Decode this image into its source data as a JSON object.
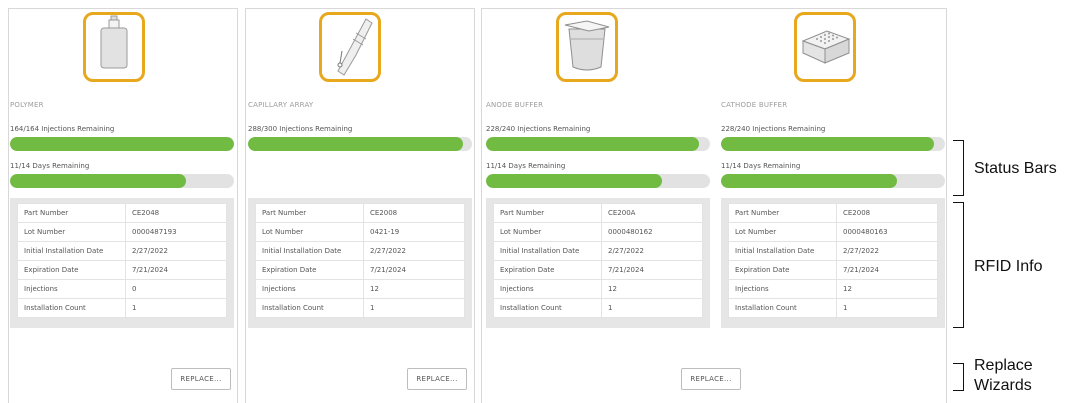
{
  "consumables": [
    {
      "name": "POLYMER",
      "icon": "polymer-pouch-icon",
      "injections_label": "164/164 Injections Remaining",
      "injections_fraction": 1.0,
      "days_label": "11/14 Days Remaining",
      "days_fraction": 0.786,
      "rfid": [
        {
          "label": "Part Number",
          "value": "CE2048"
        },
        {
          "label": "Lot Number",
          "value": "0000487193"
        },
        {
          "label": "Initial Installation Date",
          "value": "2/27/2022"
        },
        {
          "label": "Expiration Date",
          "value": "7/21/2024"
        },
        {
          "label": "Injections",
          "value": "0"
        },
        {
          "label": "Installation Count",
          "value": "1"
        }
      ],
      "replace_label": "REPLACE..."
    },
    {
      "name": "CAPILLARY ARRAY",
      "icon": "capillary-array-icon",
      "injections_label": "288/300 Injections Remaining",
      "injections_fraction": 0.96,
      "rfid": [
        {
          "label": "Part Number",
          "value": "CE2008"
        },
        {
          "label": "Lot Number",
          "value": "0421-19"
        },
        {
          "label": "Initial Installation Date",
          "value": "2/27/2022"
        },
        {
          "label": "Expiration Date",
          "value": "7/21/2024"
        },
        {
          "label": "Injections",
          "value": "12"
        },
        {
          "label": "Installation Count",
          "value": "1"
        }
      ],
      "replace_label": "REPLACE..."
    },
    {
      "name": "ANODE BUFFER",
      "icon": "anode-buffer-container-icon",
      "injections_label": "228/240 Injections Remaining",
      "injections_fraction": 0.95,
      "days_label": "11/14 Days Remaining",
      "days_fraction": 0.786,
      "rfid": [
        {
          "label": "Part Number",
          "value": "CE200A"
        },
        {
          "label": "Lot Number",
          "value": "0000480162"
        },
        {
          "label": "Initial Installation Date",
          "value": "2/27/2022"
        },
        {
          "label": "Expiration Date",
          "value": "7/21/2024"
        },
        {
          "label": "Injections",
          "value": "12"
        },
        {
          "label": "Installation Count",
          "value": "1"
        }
      ]
    },
    {
      "name": "CATHODE BUFFER",
      "icon": "cathode-buffer-reservoir-icon",
      "injections_label": "228/240 Injections Remaining",
      "injections_fraction": 0.95,
      "days_label": "11/14 Days Remaining",
      "days_fraction": 0.786,
      "rfid": [
        {
          "label": "Part Number",
          "value": "CE2008"
        },
        {
          "label": "Lot Number",
          "value": "0000480163"
        },
        {
          "label": "Initial Installation Date",
          "value": "2/27/2022"
        },
        {
          "label": "Expiration Date",
          "value": "7/21/2024"
        },
        {
          "label": "Injections",
          "value": "12"
        },
        {
          "label": "Installation Count",
          "value": "1"
        }
      ]
    }
  ],
  "buffer_replace_label": "REPLACE...",
  "annotations": {
    "status_bars": "Status Bars",
    "rfid_info": "RFID Info",
    "replace_line1": "Replace",
    "replace_line2": "Wizards"
  },
  "colors": {
    "accent_border": "#e8a81e",
    "bar_fill": "#72bb42",
    "bar_track": "#e2e2e2"
  }
}
